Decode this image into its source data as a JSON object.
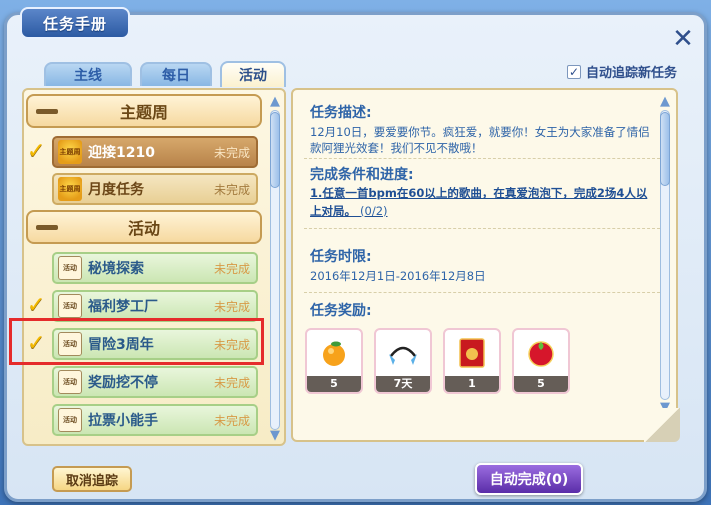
{
  "window": {
    "title": "任务手册",
    "close_glyph": "✕"
  },
  "tabs": [
    {
      "label": "主线",
      "active": false
    },
    {
      "label": "每日",
      "active": false
    },
    {
      "label": "活动",
      "active": true
    }
  ],
  "auto_track": {
    "label": "自动追踪新任务",
    "checked": true
  },
  "categories": [
    {
      "label": "主题周",
      "items": [
        {
          "icon_text": "主题周",
          "name": "迎接1210",
          "status": "未完成",
          "tracked": true,
          "selected": true
        },
        {
          "icon_text": "主题周",
          "name": "月度任务",
          "status": "未完成",
          "tracked": false,
          "selected": false
        }
      ]
    },
    {
      "label": "活动",
      "items": [
        {
          "icon_text": "活动",
          "name": "秘境探索",
          "status": "未完成",
          "tracked": false
        },
        {
          "icon_text": "活动",
          "name": "福利梦工厂",
          "status": "未完成",
          "tracked": true
        },
        {
          "icon_text": "活动",
          "name": "冒险3周年",
          "status": "未完成",
          "tracked": true,
          "highlighted": true
        },
        {
          "icon_text": "活动",
          "name": "奖励挖不停",
          "status": "未完成",
          "tracked": false
        },
        {
          "icon_text": "活动",
          "name": "拉票小能手",
          "status": "未完成",
          "tracked": false
        }
      ]
    }
  ],
  "detail": {
    "desc_title": "任务描述:",
    "desc_text": "12月10日，要爱要你节。疯狂爱，就要你！女王为大家准备了情侣款阿狸光效套！我们不见不散哦！",
    "cond_title": "完成条件和进度:",
    "cond_text": "1.任意一首bpm在60以上的歌曲，在真爱泡泡下，完成2场4人以上对局。",
    "cond_progress": "(0/2)",
    "time_title": "任务时限:",
    "time_text": "2016年12月1日-2016年12月8日",
    "reward_title": "任务奖励:",
    "rewards": [
      {
        "icon": "orange-icon",
        "qty": "5"
      },
      {
        "icon": "headphones-icon",
        "qty": "7天"
      },
      {
        "icon": "red-envelope-icon",
        "qty": "1"
      },
      {
        "icon": "growth-badge-icon",
        "qty": "5"
      }
    ]
  },
  "buttons": {
    "cancel_track": "取消追踪",
    "auto_complete": "自动完成(0)"
  },
  "check_glyph": "✓",
  "colors": {
    "accent": "#2e64a8",
    "highlight": "#e52b2b",
    "check": "#f2b800"
  }
}
